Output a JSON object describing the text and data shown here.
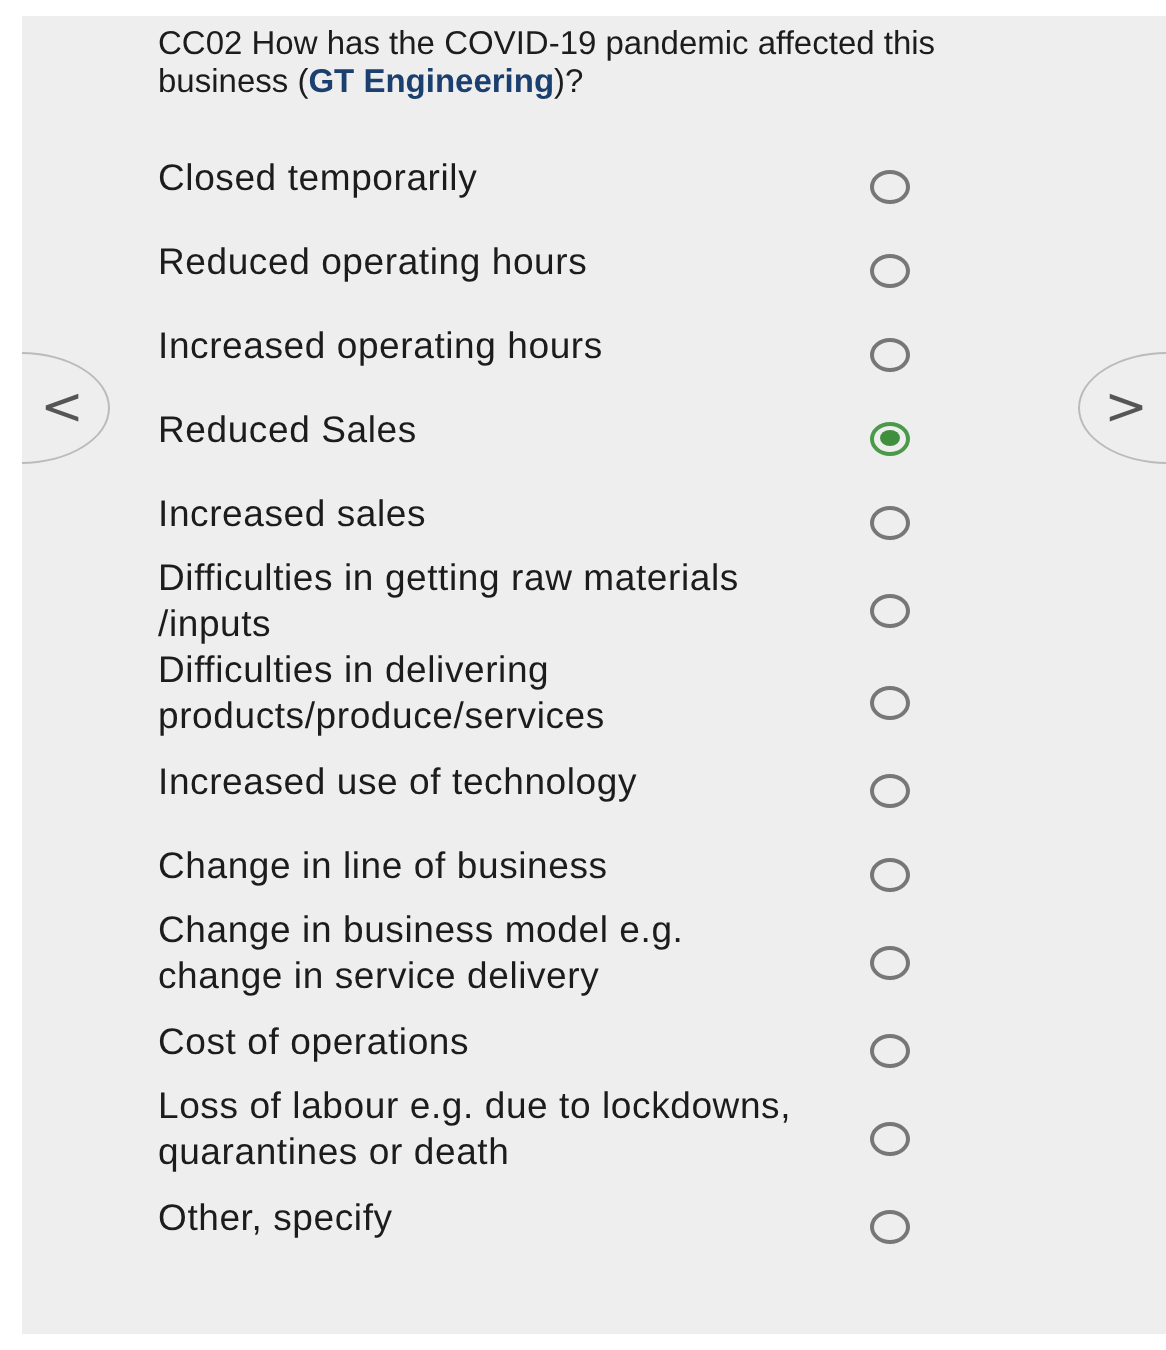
{
  "question": "CC02 How has the COVID-19 pandemic affected this business (**GT Engineering**)?",
  "options": [
    {
      "label": "Closed temporarily",
      "selected": false
    },
    {
      "label": "Reduced operating hours",
      "selected": false
    },
    {
      "label": "Increased operating hours",
      "selected": false
    },
    {
      "label": "Reduced Sales",
      "selected": true
    },
    {
      "label": "Increased sales",
      "selected": false
    },
    {
      "label": "Difficulties in getting raw materials /inputs",
      "selected": false
    },
    {
      "label": "Difficulties in delivering products/produce/services",
      "selected": false
    },
    {
      "label": "Increased use of technology",
      "selected": false
    },
    {
      "label": "Change in line of business",
      "selected": false
    },
    {
      "label": "Change in business model e.g. change in service delivery",
      "selected": false
    },
    {
      "label": "Cost of operations",
      "selected": false
    },
    {
      "label": "Loss of labour e.g. due to lockdowns, quarantines or death",
      "selected": false
    },
    {
      "label": "Other, specify",
      "selected": false
    }
  ],
  "nav": {
    "previous": "<",
    "next": ">"
  }
}
